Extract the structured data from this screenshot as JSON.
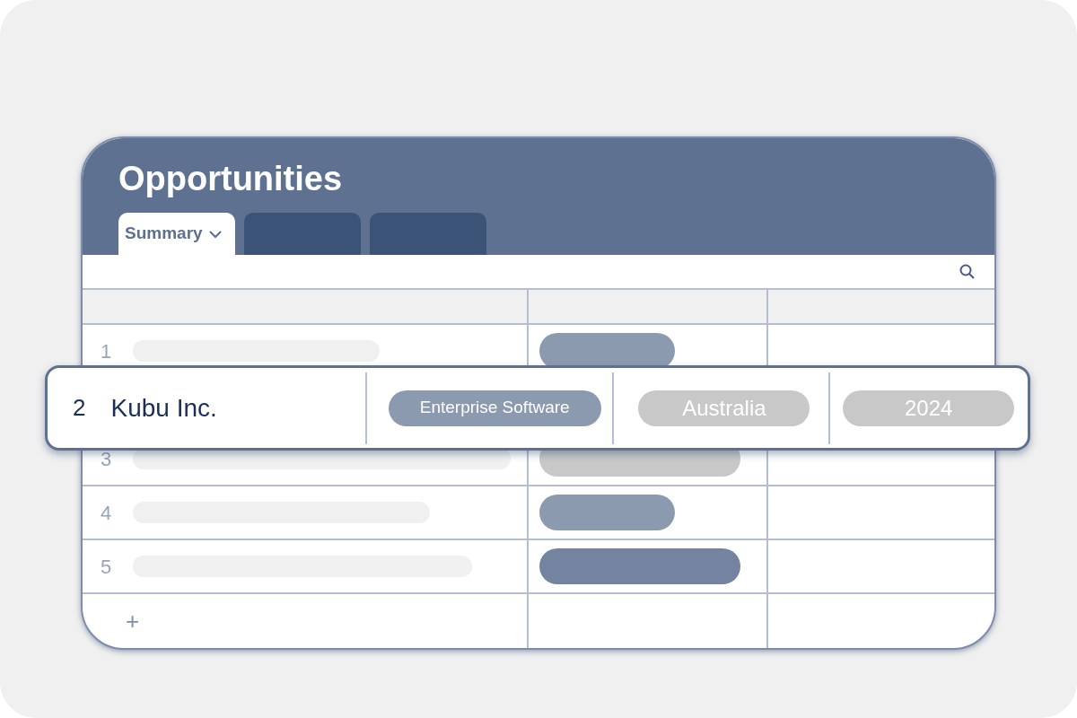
{
  "title": "Opportunities",
  "tabs": [
    {
      "label": "Summary",
      "selected": true
    },
    {
      "selected": false
    },
    {
      "selected": false
    }
  ],
  "rows": [
    {
      "number": "1",
      "color": "#8c9ab0"
    },
    {
      "number": "3",
      "color": "#c8c8c8"
    },
    {
      "number": "4",
      "color": "#8c9ab0"
    },
    {
      "number": "5",
      "color": "#7484a0"
    }
  ],
  "add_row": "+",
  "highlighted_row": {
    "number": "2",
    "name": "Kubu Inc.",
    "tags": [
      {
        "label": "Enterprise Software",
        "color": "#8c9ab0"
      },
      {
        "label": "Australia",
        "color": "#c8c8c8"
      },
      {
        "label": "2024",
        "color": "#c8c8c8"
      }
    ]
  }
}
